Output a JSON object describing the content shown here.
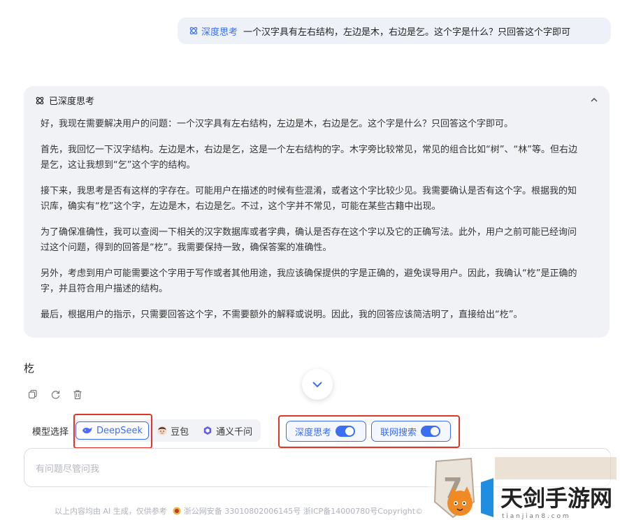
{
  "user_message": {
    "tag": "深度思考",
    "text": "一个汉字具有左右结构，左边是木，右边是乞。这个字是什么？只回答这个字即可"
  },
  "thinking": {
    "title": "已深度思考",
    "paragraphs": [
      "好，我现在需要解决用户的问题：一个汉字具有左右结构，左边是木，右边是乞。这个字是什么？只回答这个字即可。",
      "首先，我回忆一下汉字结构。左边是木，右边是乞，这是一个左右结构的字。木字旁比较常见，常见的组合比如“树”、“林”等。但右边是乞，这让我想到“乞”这个字的结构。",
      "接下来，我思考是否有这样的字存在。可能用户在描述的时候有些混淆，或者这个字比较少见。我需要确认是否有这个字。根据我的知识库，确实有“杚”这个字，左边是木，右边是乞。不过，这个字并不常见，可能在某些古籍中出现。",
      "为了确保准确性，我可以查阅一下相关的汉字数据库或者字典，确认是否存在这个字以及它的正确写法。此外，用户之前可能已经询问过这个问题，得到的回答是“杚”。我需要保持一致，确保答案的准确性。",
      "另外，考虑到用户可能需要这个字用于写作或者其他用途，我应该确保提供的字是正确的，避免误导用户。因此，我确认“杚”是正确的字，并且符合用户描述的结构。",
      "最后，根据用户的指示，只需要回答这个字，不需要额外的解释或说明。因此，我的回答应该简洁明了，直接给出“杚”。"
    ]
  },
  "answer": "杚",
  "model_select": {
    "label": "模型选择",
    "options": [
      {
        "name": "DeepSeek",
        "active": true
      },
      {
        "name": "豆包",
        "active": false
      },
      {
        "name": "通义千问",
        "active": false
      }
    ]
  },
  "toggles": {
    "deep_think": {
      "label": "深度思考",
      "on": true
    },
    "web_search": {
      "label": "联网搜索",
      "on": true
    }
  },
  "input": {
    "placeholder": "有问题尽管问我"
  },
  "footer": {
    "disclaimer": "以上内容均由 AI 生成，仅供参考",
    "police_record": "浙公网安备 33010802006145号 浙ICP备14000780号Copyright©"
  },
  "watermark": {
    "site_name": "天剑手游网",
    "site_domain": "t i a n j i a n 8 . c o m"
  },
  "colors": {
    "accent": "#3b6ef0",
    "highlight_box": "#e0352b",
    "panel_bg": "#f1f2f5"
  }
}
